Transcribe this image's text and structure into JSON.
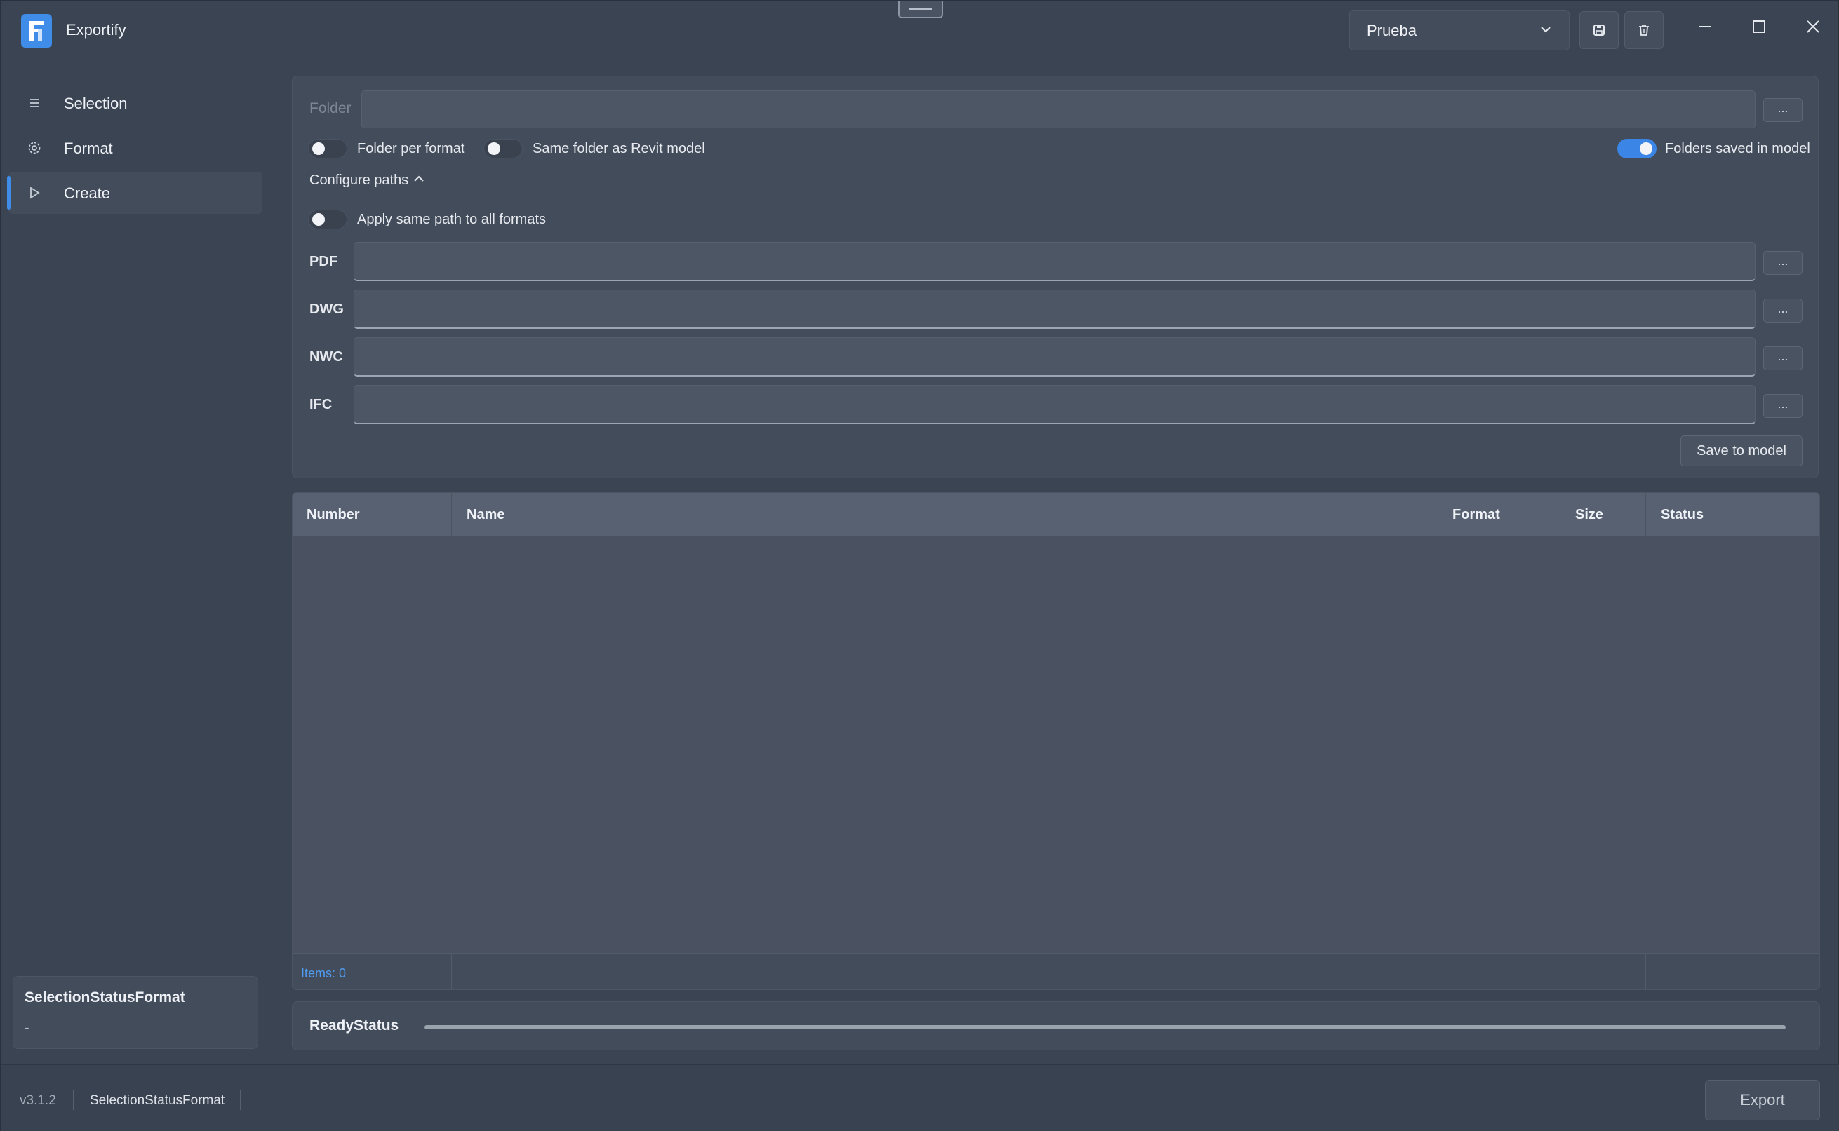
{
  "app": {
    "title": "Exportify"
  },
  "header": {
    "profile_value": "Prueba"
  },
  "sidebar": {
    "items": [
      {
        "label": "Selection",
        "icon": "list-icon",
        "active": false
      },
      {
        "label": "Format",
        "icon": "gear-icon",
        "active": false
      },
      {
        "label": "Create",
        "icon": "play-icon",
        "active": true
      }
    ],
    "status_card": {
      "title": "SelectionStatusFormat",
      "detail": "-"
    }
  },
  "paths": {
    "folder_label": "Folder",
    "folder_value": "",
    "browse_label": "...",
    "folder_per_format": {
      "label": "Folder per format",
      "on": false
    },
    "same_folder_revit": {
      "label": "Same folder as Revit model",
      "on": false
    },
    "folders_saved": {
      "label": "Folders saved in model",
      "on": true
    },
    "configure_label": "Configure paths",
    "apply_same": {
      "label": "Apply same path to all formats",
      "on": false
    },
    "formats": [
      {
        "label": "PDF",
        "value": ""
      },
      {
        "label": "DWG",
        "value": ""
      },
      {
        "label": "NWC",
        "value": ""
      },
      {
        "label": "IFC",
        "value": ""
      }
    ],
    "save_label": "Save to model"
  },
  "table": {
    "columns": [
      "Number",
      "Name",
      "Format",
      "Size",
      "Status"
    ],
    "rows": [],
    "footer_items": "Items: 0"
  },
  "status": {
    "label": "ReadyStatus",
    "progress": 0
  },
  "footer": {
    "version": "v3.1.2",
    "status": "SelectionStatusFormat",
    "export_label": "Export"
  },
  "colors": {
    "accent": "#3f8de8",
    "background": "#3a4453",
    "panel": "#434c5b"
  }
}
